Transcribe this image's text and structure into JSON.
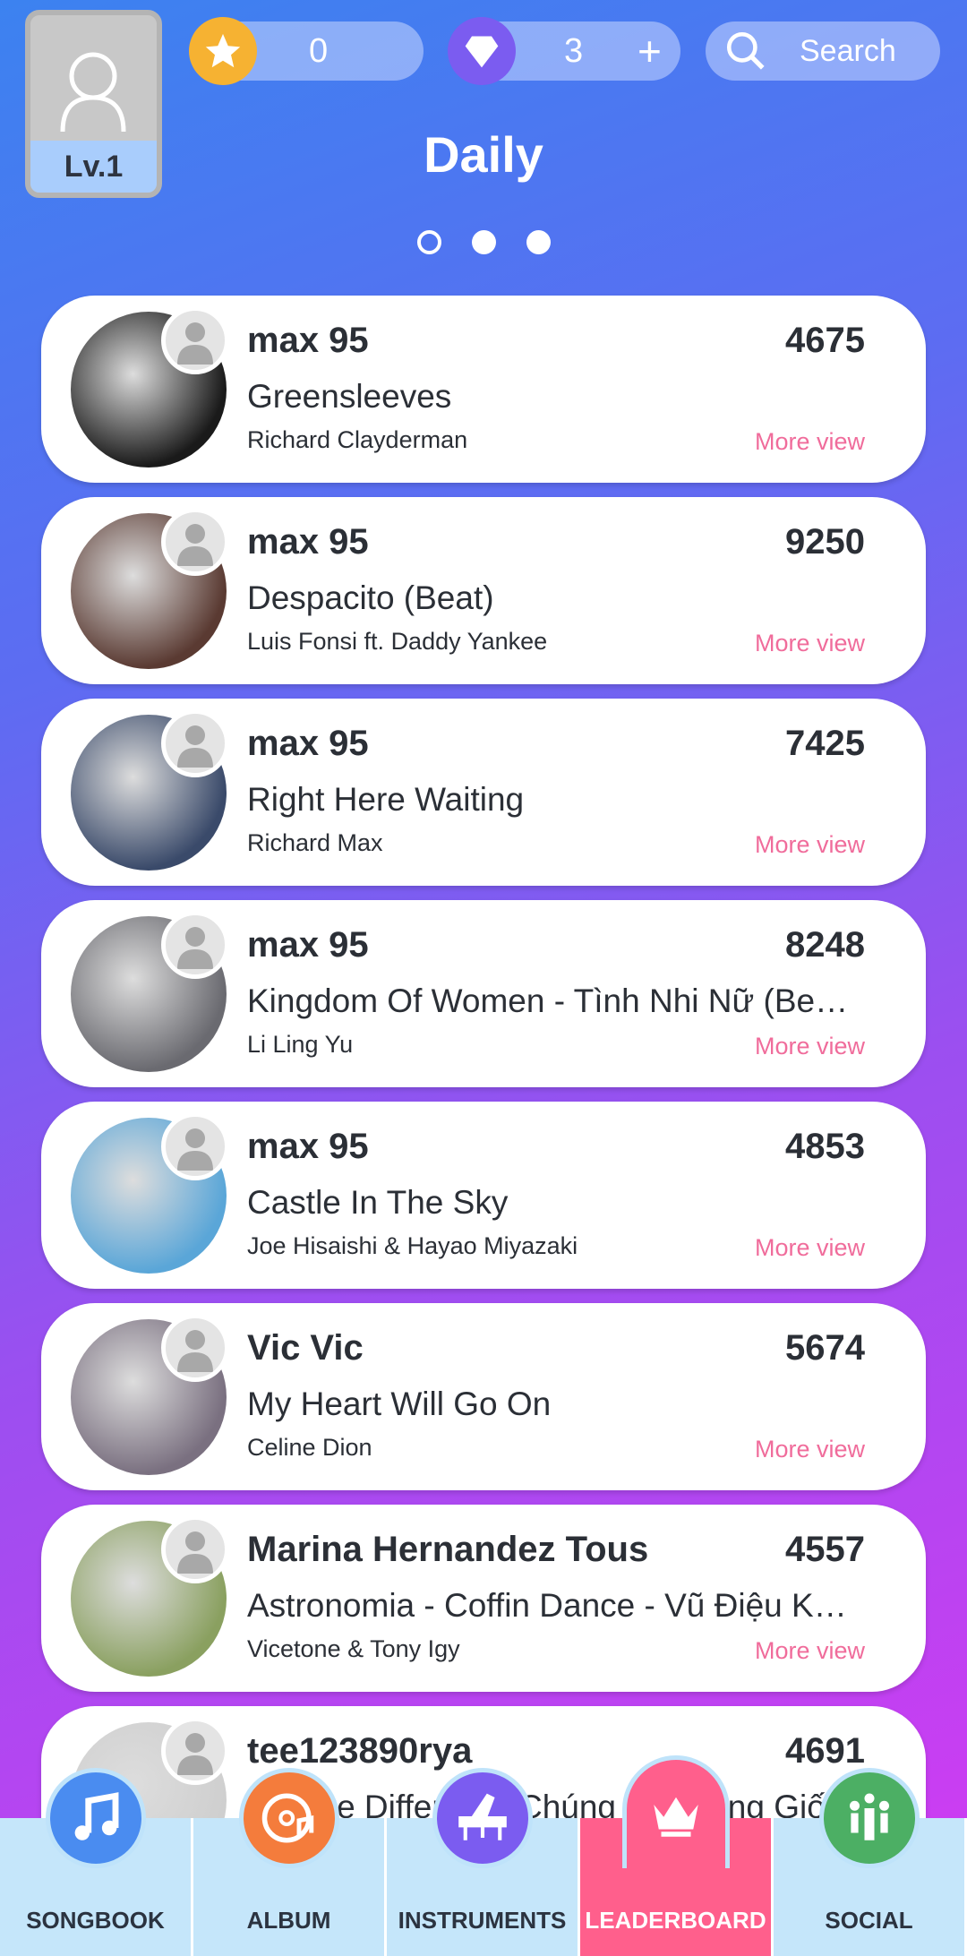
{
  "header": {
    "level": "Lv.1",
    "stars": "0",
    "gems": "3",
    "gems_add": "+",
    "search_placeholder": "Search",
    "title": "Daily"
  },
  "pager": {
    "pages": 3,
    "active": 0
  },
  "entries": [
    {
      "name": "max 95",
      "score": "4675",
      "song": "Greensleeves",
      "artist": "Richard Clayderman",
      "more": "More view",
      "album_color": "#1a1a1a"
    },
    {
      "name": "max 95",
      "score": "9250",
      "song": "Despacito (Beat)",
      "artist": "Luis Fonsi ft. Daddy Yankee",
      "more": "More view",
      "album_color": "#5a3a32"
    },
    {
      "name": "max 95",
      "score": "7425",
      "song": "Right Here Waiting",
      "artist": "Richard Max",
      "more": "More view",
      "album_color": "#3a4a6a"
    },
    {
      "name": "max 95",
      "score": "8248",
      "song": "Kingdom Of Women - Tình Nhi Nữ (Beat...",
      "artist": "Li Ling Yu",
      "more": "More view",
      "album_color": "#6a6a70"
    },
    {
      "name": "max 95",
      "score": "4853",
      "song": "Castle In The Sky",
      "artist": "Joe Hisaishi & Hayao Miyazaki",
      "more": "More view",
      "album_color": "#5aa6d8"
    },
    {
      "name": "Vic Vic",
      "score": "5674",
      "song": "My Heart Will Go On",
      "artist": "Celine Dion",
      "more": "More view",
      "album_color": "#7a7080"
    },
    {
      "name": "Marina Hernandez Tous",
      "score": "4557",
      "song": "Astronomia - Coffin Dance - Vũ Điệu Khi...",
      "artist": "Vicetone & Tony Igy",
      "more": "More view",
      "album_color": "#8aa060"
    },
    {
      "name": "tee123890rya",
      "score": "4691",
      "song": "We Are Different - Chúng Ta Không Giống",
      "artist": "",
      "more": "",
      "album_color": "#cfcfcf"
    }
  ],
  "nav": [
    {
      "label": "SONGBOOK",
      "icon": "music-note-icon",
      "color": "#4a8cf0"
    },
    {
      "label": "ALBUM",
      "icon": "album-disc-icon",
      "color": "#f47c3c"
    },
    {
      "label": "INSTRUMENTS",
      "icon": "piano-icon",
      "color": "#7b5cf0"
    },
    {
      "label": "LEADERBOARD",
      "icon": "crown-icon",
      "color": "#ff5f8c",
      "active": true
    },
    {
      "label": "SOCIAL",
      "icon": "people-icon",
      "color": "#4caf64"
    }
  ]
}
